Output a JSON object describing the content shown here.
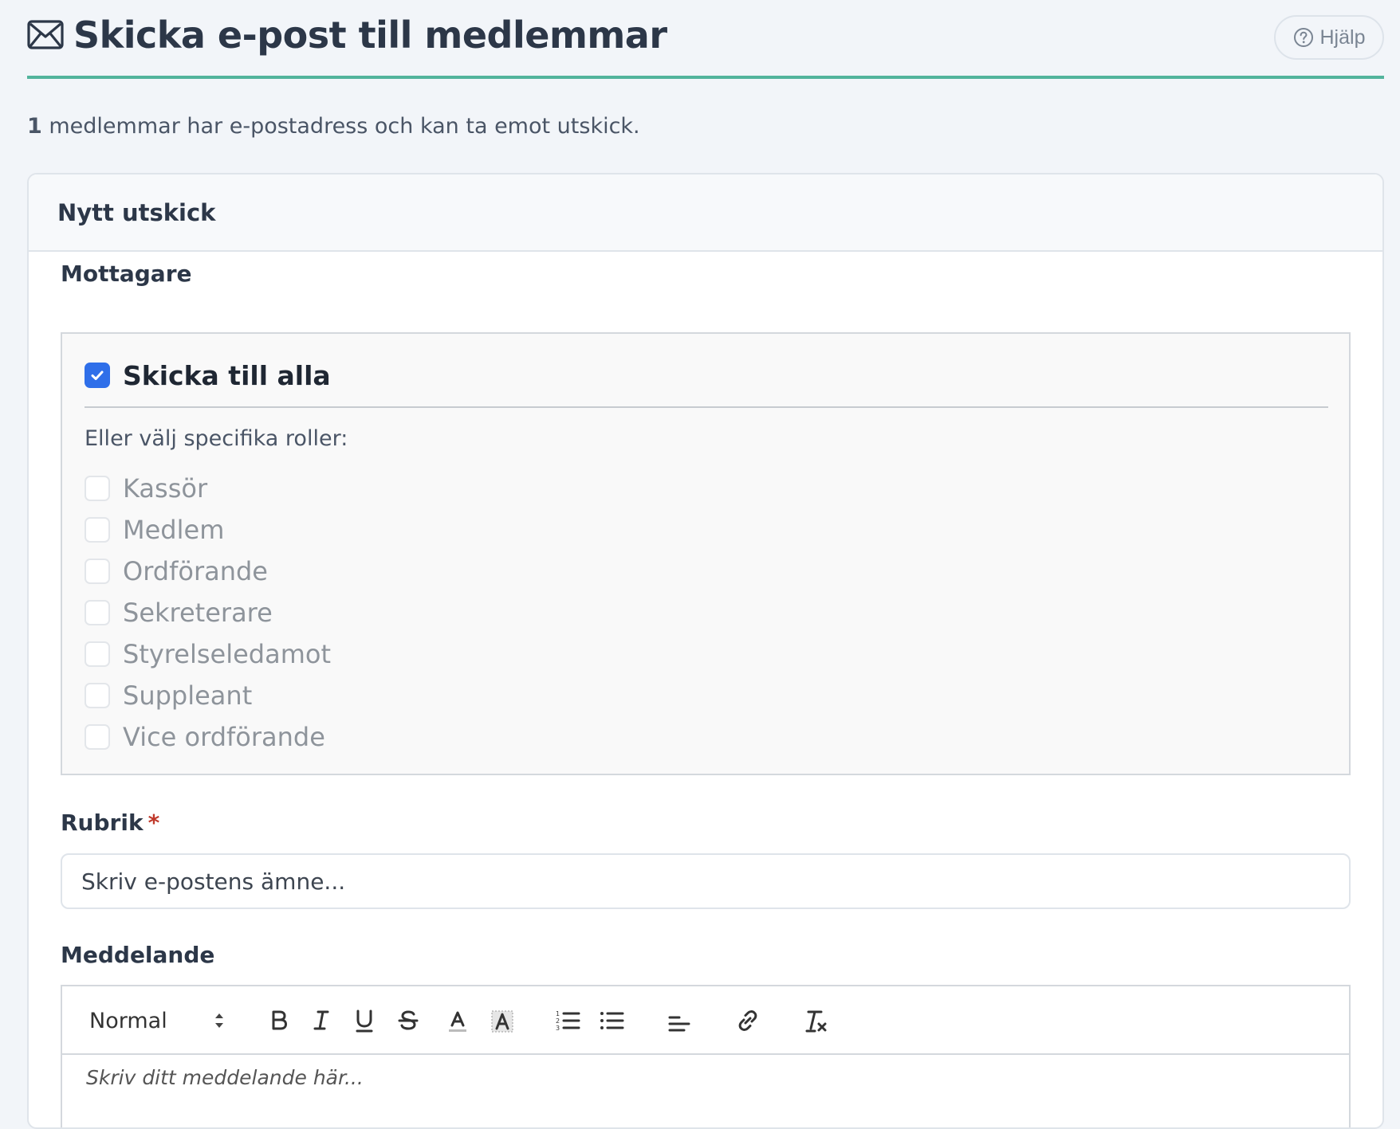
{
  "header": {
    "title": "Skicka e-post till medlemmar",
    "help_label": "Hjälp",
    "icon": "envelope-icon"
  },
  "intro": {
    "count": "1",
    "text": " medlemmar har e-postadress och kan ta emot utskick."
  },
  "card": {
    "title": "Nytt utskick",
    "recipients": {
      "label": "Mottagare",
      "send_all_label": "Skicka till alla",
      "send_all_checked": true,
      "roles_hint": "Eller välj specifika roller:",
      "roles": [
        {
          "label": "Kassör",
          "checked": false
        },
        {
          "label": "Medlem",
          "checked": false
        },
        {
          "label": "Ordförande",
          "checked": false
        },
        {
          "label": "Sekreterare",
          "checked": false
        },
        {
          "label": "Styrelseledamot",
          "checked": false
        },
        {
          "label": "Suppleant",
          "checked": false
        },
        {
          "label": "Vice ordförande",
          "checked": false
        }
      ]
    },
    "subject": {
      "label": "Rubrik",
      "required_mark": "*",
      "placeholder": "Skriv e-postens ämne...",
      "value": ""
    },
    "message": {
      "label": "Meddelande",
      "format_value": "Normal",
      "placeholder": "Skriv ditt meddelande här...",
      "toolbar": [
        "bold-icon",
        "italic-icon",
        "underline-icon",
        "strikethrough-icon",
        "text-color-icon",
        "highlight-icon",
        "ordered-list-icon",
        "bullet-list-icon",
        "align-icon",
        "link-icon",
        "clear-format-icon"
      ]
    }
  },
  "colors": {
    "accent": "#52b49c",
    "checkbox": "#2f6fe9",
    "required": "#c0392b",
    "background": "#f2f5f9"
  }
}
